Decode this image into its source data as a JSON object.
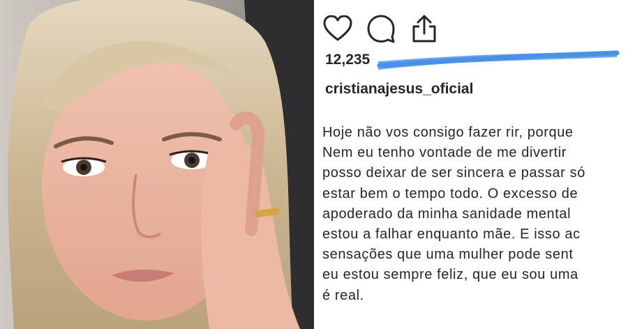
{
  "post": {
    "actions": [
      {
        "icon": "heart-icon"
      },
      {
        "icon": "comment-icon"
      },
      {
        "icon": "share-icon"
      }
    ],
    "likes_count": "12,235",
    "username": "cristianajesus_oficial",
    "caption_lines": [
      "Hoje não vos consigo fazer rir, porque",
      "Nem eu tenho vontade de me divertir",
      "posso deixar de ser sincera e passar só",
      "estar bem o tempo todo. O excesso de",
      "apoderado da minha sanidade mental",
      "estou a falhar enquanto mãe. E isso ac",
      "sensações que uma mulher pode sent",
      "eu estou sempre feliz, que eu sou uma",
      "é real."
    ]
  },
  "colors": {
    "text": "#262626",
    "scribble": "#5aa0f0"
  }
}
